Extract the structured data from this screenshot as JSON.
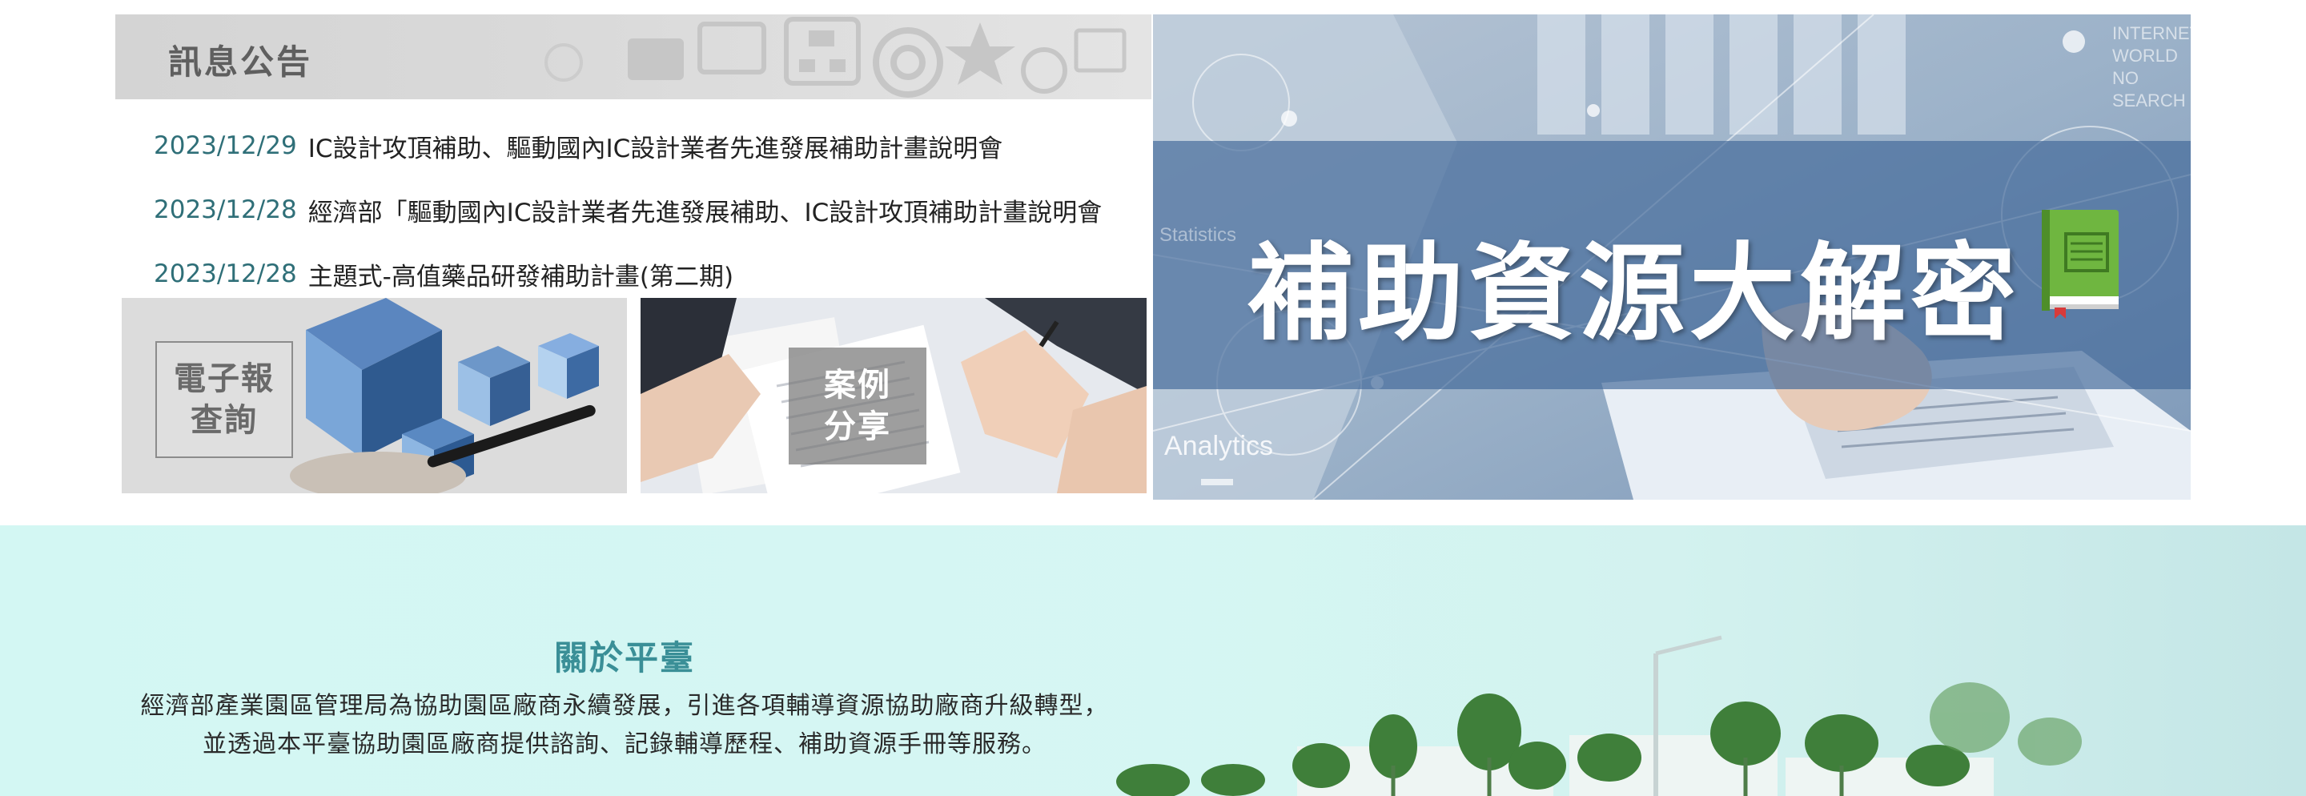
{
  "news": {
    "header": "訊息公告",
    "items": [
      {
        "date": "2023/12/29",
        "title": "IC設計攻頂補助、驅動國內IC設計業者先進發展補助計畫說明會"
      },
      {
        "date": "2023/12/28",
        "title": "經濟部「驅動國內IC設計業者先進發展補助、IC設計攻頂補助計畫說明會"
      },
      {
        "date": "2023/12/28",
        "title": "主題式-高值藥品研發補助計畫(第二期)"
      }
    ]
  },
  "cards": {
    "epaper_line1": "電子報",
    "epaper_line2": "查詢",
    "cases_line1": "案例",
    "cases_line2": "分享"
  },
  "banner": {
    "title": "補助資源大解密",
    "word_analytics": "Analytics",
    "word_statistics": "Statistics",
    "word_internet": [
      "INTERNET",
      "WORLD",
      "NO",
      "SEARCH"
    ],
    "icon": "book-icon"
  },
  "about": {
    "title": "關於平臺",
    "line1": "經濟部產業園區管理局為協助園區廠商永續發展，引進各項輔導資源協助廠商升級轉型，",
    "line2": "並透過本平臺協助園區廠商提供諮詢、記錄輔導歷程、補助資源手冊等服務。"
  },
  "colors": {
    "date_teal": "#2f6f78",
    "about_title": "#3a8f97",
    "about_bg": "#d3f7f3",
    "banner_band": "#42689a"
  }
}
